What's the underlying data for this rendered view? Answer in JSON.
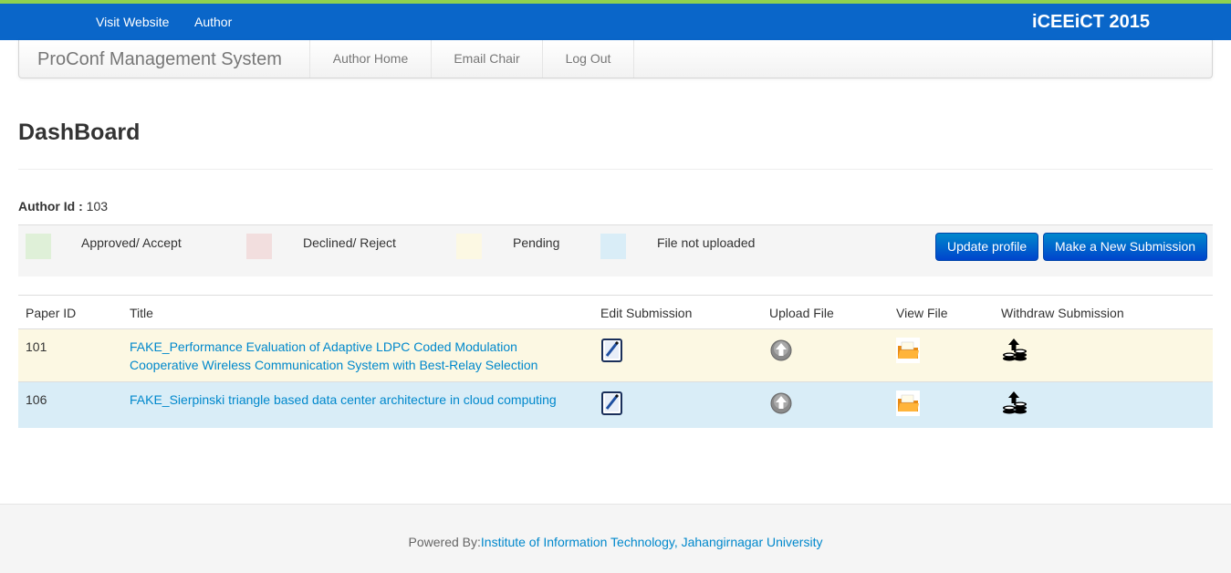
{
  "topbar": {
    "links": [
      "Visit Website",
      "Author"
    ],
    "brand": "iCEEiCT 2015",
    "bg_color": "#0a66c9"
  },
  "navbar": {
    "brand": "ProConf Management System",
    "items": [
      "Author Home",
      "Email Chair",
      "Log Out"
    ]
  },
  "page": {
    "title": "DashBoard",
    "author_id_label": "Author Id :",
    "author_id_value": "103"
  },
  "legend": {
    "items": [
      {
        "label": "Approved/ Accept",
        "color": "#dff0d8"
      },
      {
        "label": "Declined/ Reject",
        "color": "#f2dede"
      },
      {
        "label": "Pending",
        "color": "#fcf8e3"
      },
      {
        "label": "File not uploaded",
        "color": "#d9edf7"
      }
    ],
    "update_profile_label": "Update profile",
    "new_submission_label": "Make a New Submission"
  },
  "table": {
    "headers": [
      "Paper ID",
      "Title",
      "Edit Submission",
      "Upload File",
      "View File",
      "Withdraw Submission"
    ],
    "rows": [
      {
        "paper_id": "101",
        "title": "FAKE_Performance Evaluation of Adaptive LDPC Coded Modulation Cooperative Wireless Communication System with Best-Relay Selection",
        "status": "pending"
      },
      {
        "paper_id": "106",
        "title": "FAKE_Sierpinski triangle based data center architecture in cloud computing",
        "status": "file-not-uploaded"
      }
    ],
    "icons": {
      "edit": "edit-notepad-icon",
      "upload": "upload-arrow-icon",
      "view": "folder-icon",
      "withdraw": "withdraw-coins-icon"
    }
  },
  "footer": {
    "powered_by_label": "Powered By:",
    "powered_by_link": "Institute of Information Technology, Jahangirnagar University"
  }
}
